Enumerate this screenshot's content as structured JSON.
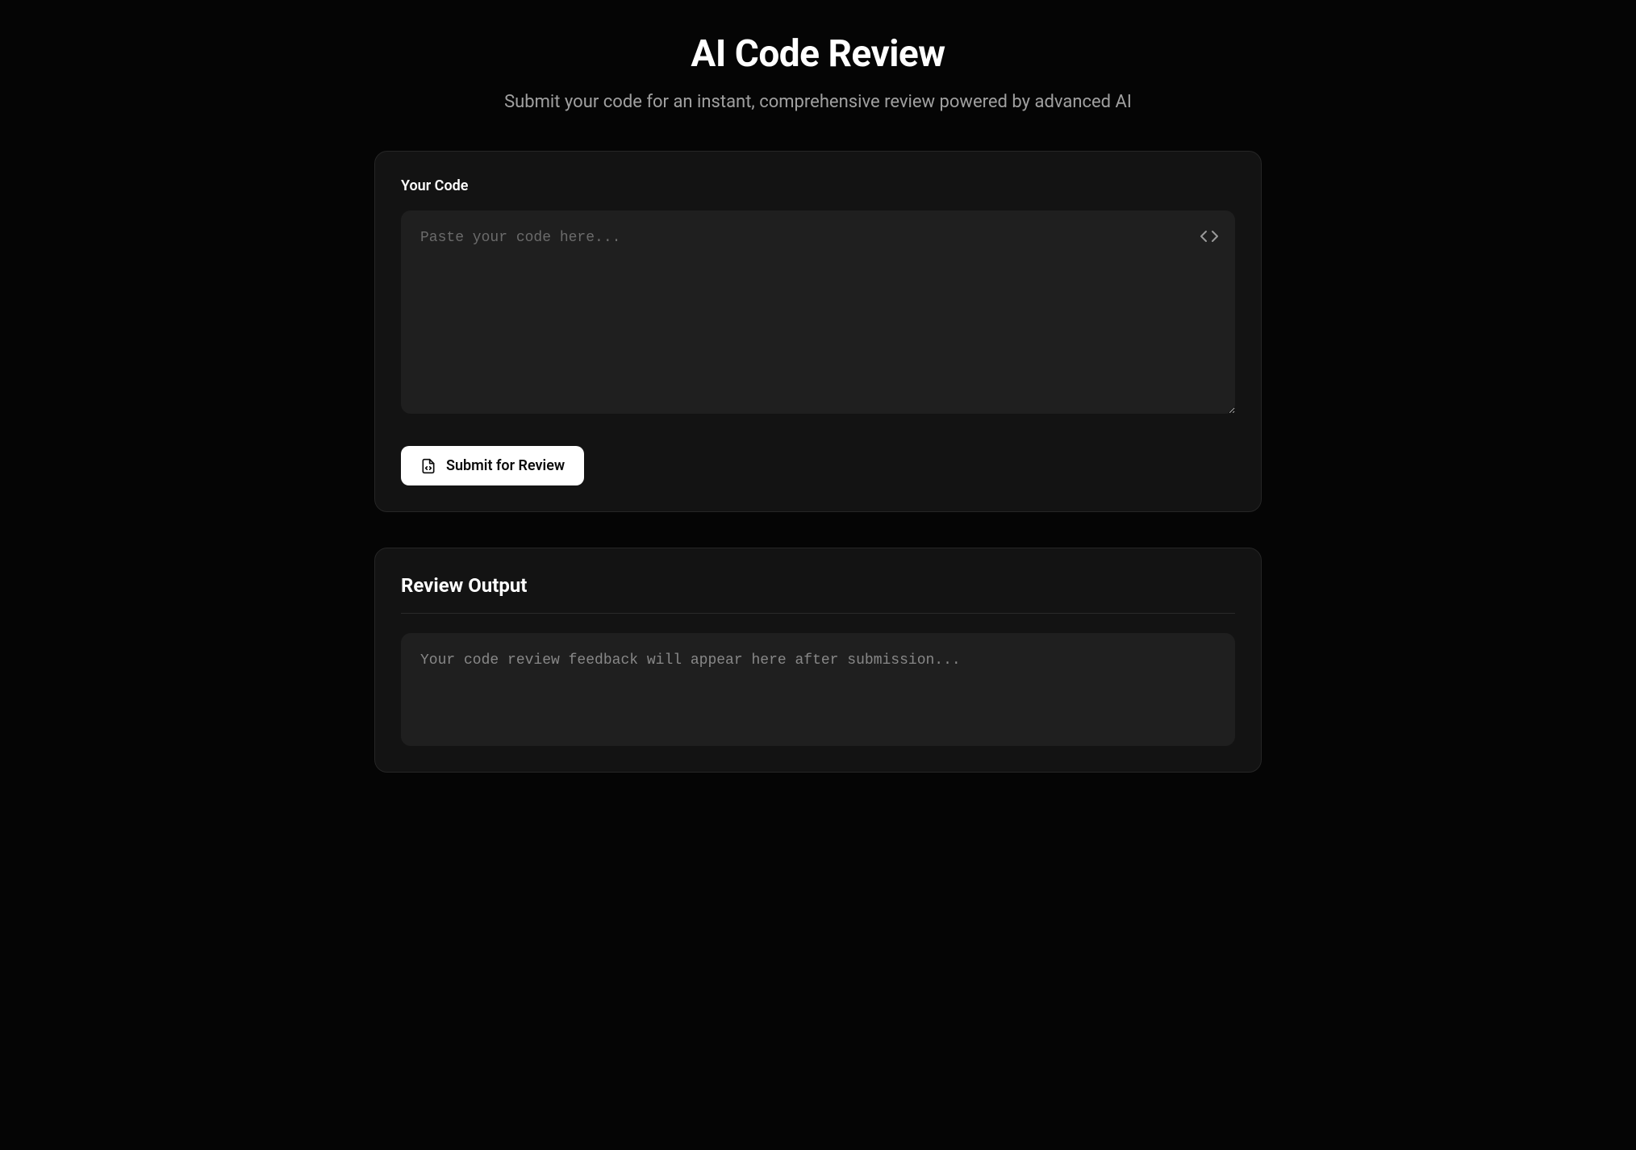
{
  "header": {
    "title": "AI Code Review",
    "subtitle": "Submit your code for an instant, comprehensive review powered by advanced AI"
  },
  "input_section": {
    "label": "Your Code",
    "placeholder": "Paste your code here...",
    "submit_label": "Submit for Review"
  },
  "output_section": {
    "heading": "Review Output",
    "placeholder": "Your code review feedback will appear here after submission..."
  }
}
